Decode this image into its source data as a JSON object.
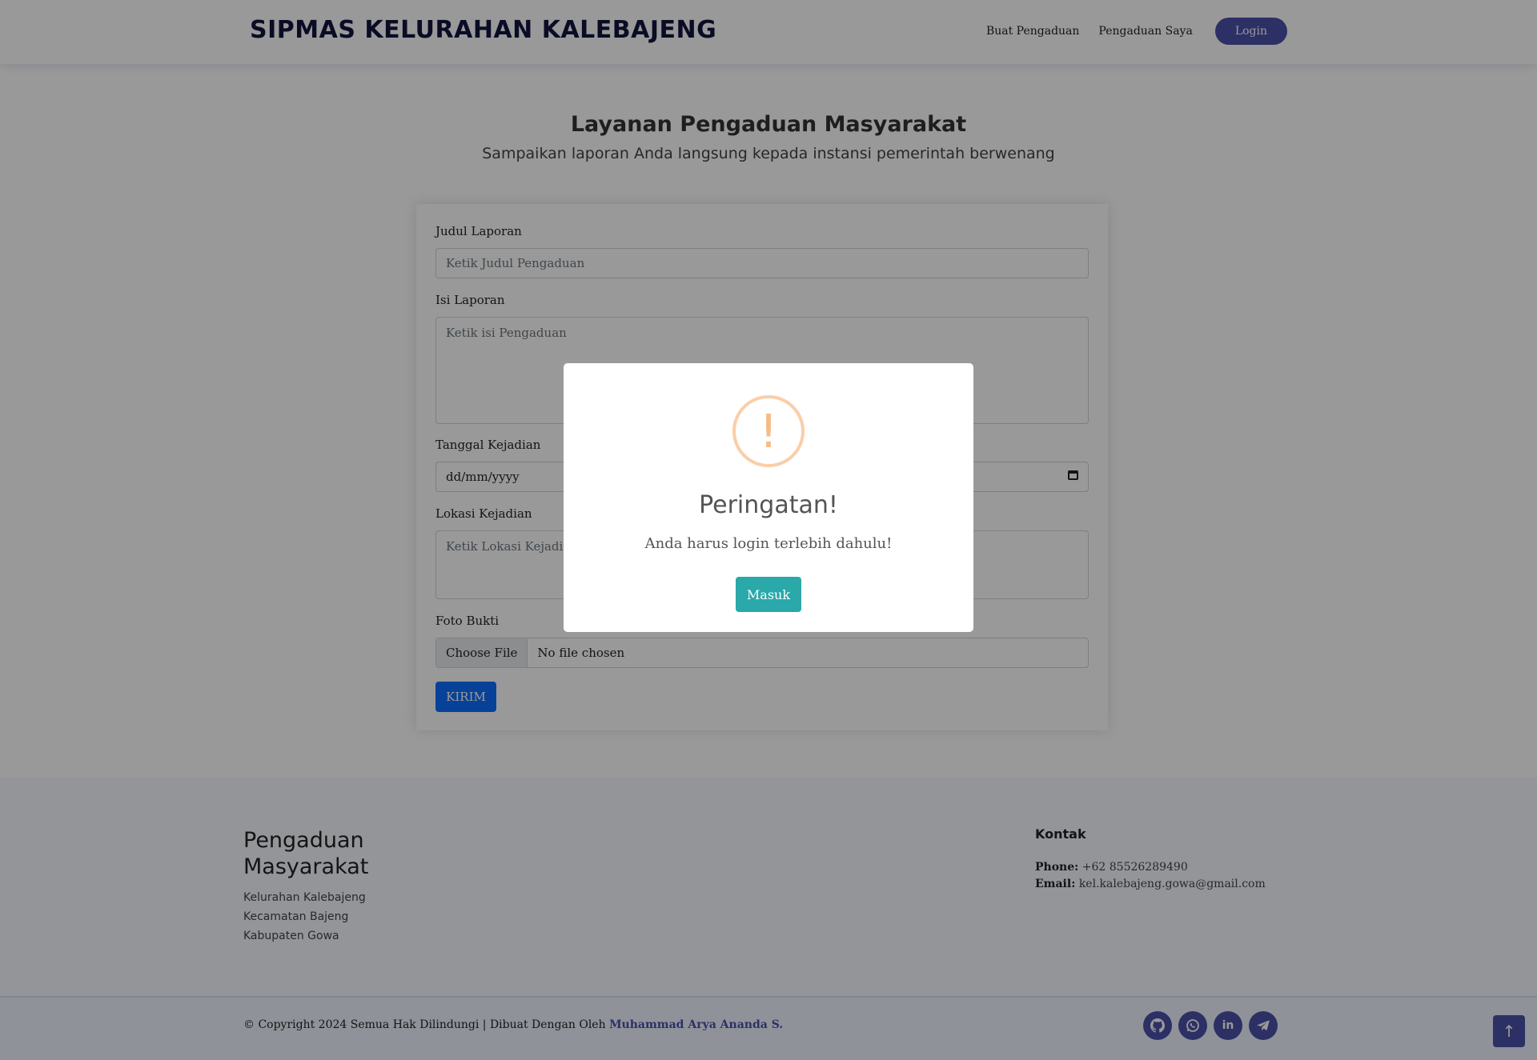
{
  "header": {
    "logo": "SIPMAS KELURAHAN KALEBAJENG",
    "nav": [
      "Buat Pengaduan",
      "Pengaduan Saya"
    ],
    "login": "Login"
  },
  "hero": {
    "title": "Layanan Pengaduan Masyarakat",
    "subtitle": "Sampaikan laporan Anda langsung kepada instansi pemerintah berwenang"
  },
  "form": {
    "judul_label": "Judul Laporan",
    "judul_placeholder": "Ketik Judul Pengaduan",
    "isi_label": "Isi Laporan",
    "isi_placeholder": "Ketik isi Pengaduan",
    "tanggal_label": "Tanggal Kejadian",
    "tanggal_value": "dd/mm/yyyy",
    "lokasi_label": "Lokasi Kejadian",
    "lokasi_placeholder": "Ketik Lokasi Kejadian",
    "foto_label": "Foto Bukti",
    "file_button": "Choose File",
    "file_status": "No file chosen",
    "submit": "KIRIM"
  },
  "footer": {
    "brand": "Pengaduan Masyarakat",
    "address": [
      "Kelurahan Kalebajeng",
      "Kecamatan Bajeng",
      "Kabupaten Gowa"
    ],
    "kontak_title": "Kontak",
    "phone_label": "Phone:",
    "phone": "+62 85526289490",
    "email_label": "Email:",
    "email": "kel.kalebajeng.gowa@gmail.com",
    "copyright": "© Copyright 2024 Semua Hak Dilindungi | Dibuat Dengan Oleh",
    "author": "Muhammad Arya Ananda S.",
    "socials": [
      "github-icon",
      "whatsapp-icon",
      "linkedin-icon",
      "telegram-icon"
    ],
    "back_to_top_icon": "arrow-up-icon"
  },
  "modal": {
    "icon": "warning-icon",
    "icon_glyph": "!",
    "title": "Peringatan!",
    "text": "Anda harus login terlebih dahulu!",
    "button": "Masuk"
  }
}
